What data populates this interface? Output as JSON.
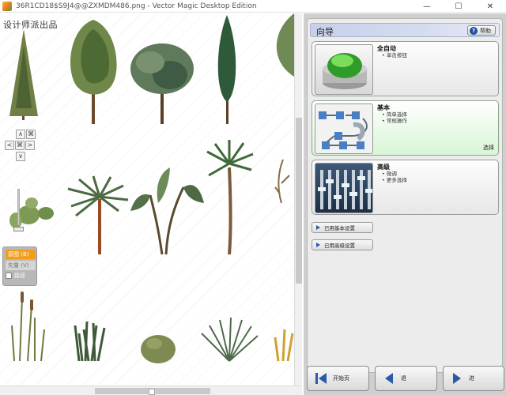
{
  "window": {
    "title": "36R1CD18$S9J4@@ZXMDM486.png - Vector Magic Desktop Edition",
    "controls": {
      "minimize": "—",
      "maximize": "☐",
      "close": "✕"
    }
  },
  "canvas": {
    "watermark": "设计师派出品",
    "nav": {
      "up": "∧",
      "down": "∨",
      "left": "<",
      "right": ">",
      "fit": "⌘",
      "actual": "⌘"
    },
    "display_mode": {
      "original_label": "原图 (B)",
      "result_label": "矢量 (V)",
      "paths_label": "路径",
      "paths_checked": false
    },
    "cursor_icon": "hand-icon"
  },
  "wizard": {
    "title": "向导",
    "help_label": "帮助",
    "options": [
      {
        "title": "全自动",
        "bullets": [
          "单击按钮"
        ],
        "selected": false,
        "thumb_icon": "green-button-icon"
      },
      {
        "title": "基本",
        "bullets": [
          "简单选择",
          "常规操作"
        ],
        "selected": true,
        "choose_label": "选择",
        "thumb_icon": "flowchart-icon"
      },
      {
        "title": "高级",
        "bullets": [
          "微调",
          "更多选择"
        ],
        "selected": false,
        "thumb_icon": "mixer-icon"
      }
    ],
    "basic_settings_label": "已用基本设置",
    "advanced_settings_label": "已用高级设置"
  },
  "footer": {
    "start_label": "开始页",
    "back_label": "退",
    "next_label": "进"
  },
  "colors": {
    "accent_orange": "#f29d1c",
    "header_blue": "#c7d0e9",
    "selected_green": "#d8f5d6",
    "arrow_blue": "#2a5aa8"
  }
}
